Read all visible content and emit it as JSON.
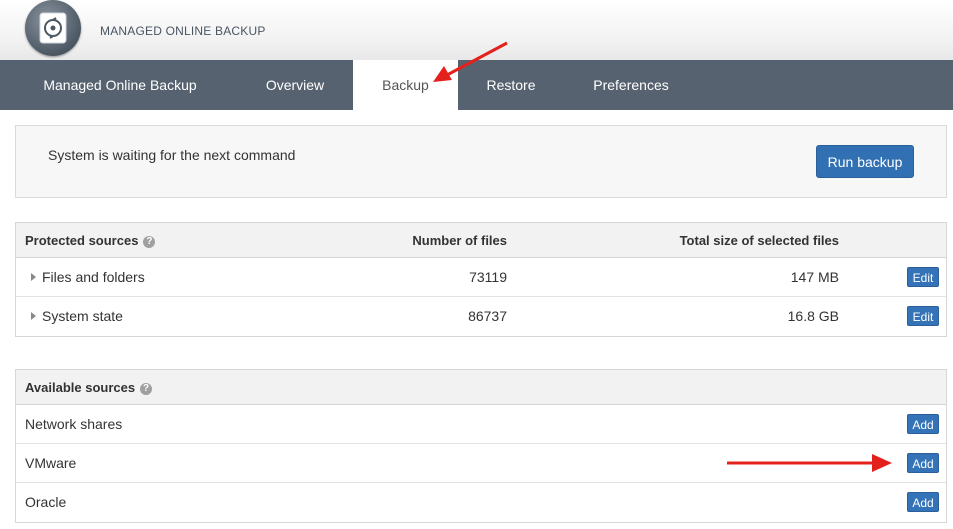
{
  "header": {
    "app_title": "MANAGED ONLINE BACKUP",
    "logo_icon": "backup-logo-icon"
  },
  "nav": {
    "tabs": [
      {
        "label": "Managed Online Backup",
        "active": false
      },
      {
        "label": "Overview",
        "active": false
      },
      {
        "label": "Backup",
        "active": true
      },
      {
        "label": "Restore",
        "active": false
      },
      {
        "label": "Preferences",
        "active": false
      }
    ]
  },
  "status_panel": {
    "message": "System is waiting for the next command",
    "run_backup_label": "Run backup"
  },
  "protected_sources": {
    "title": "Protected sources",
    "help_symbol": "?",
    "columns": [
      "Number of files",
      "Total size of selected files"
    ],
    "rows": [
      {
        "name": "Files and folders",
        "files": "73119",
        "size": "147 MB",
        "action": "Edit"
      },
      {
        "name": "System state",
        "files": "86737",
        "size": "16.8 GB",
        "action": "Edit"
      }
    ]
  },
  "available_sources": {
    "title": "Available sources",
    "help_symbol": "?",
    "rows": [
      {
        "name": "Network shares",
        "action": "Add"
      },
      {
        "name": "VMware",
        "action": "Add"
      },
      {
        "name": "Oracle",
        "action": "Add"
      }
    ]
  },
  "colors": {
    "nav_bg": "#566270",
    "primary_button": "#3270b4",
    "annotation_arrow": "#e3201b"
  }
}
